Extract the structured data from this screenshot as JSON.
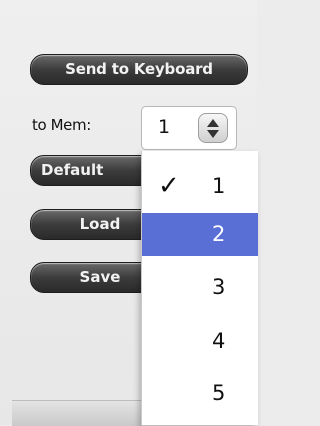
{
  "buttons": {
    "send": "Send to Keyboard",
    "default": "Default",
    "load": "Load",
    "save": "Save"
  },
  "memory": {
    "label": "to Mem:",
    "value": "1"
  },
  "menu": {
    "items": [
      "1",
      "2",
      "3",
      "4",
      "5"
    ],
    "checked": "1",
    "highlighted": "2",
    "highlight_color": "#5a6fd6"
  },
  "icons": {
    "stepper": "up-down-arrows-icon",
    "check": "checkmark-icon"
  }
}
